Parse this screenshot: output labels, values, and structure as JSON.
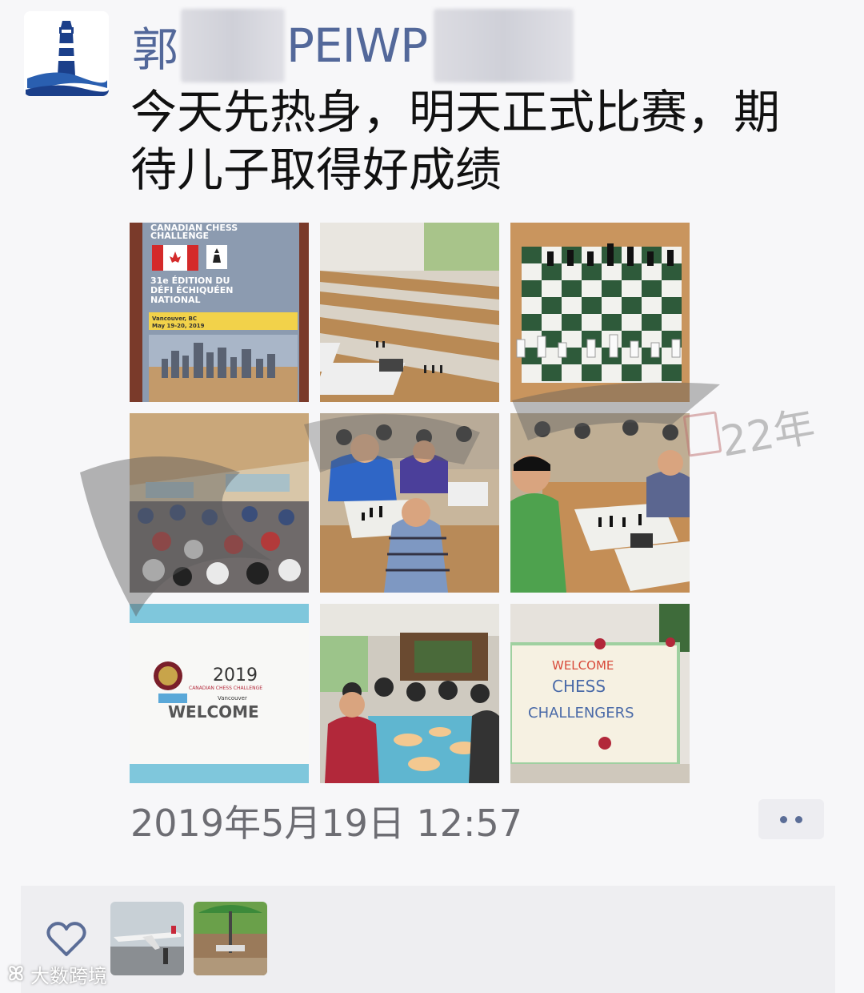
{
  "post": {
    "author_prefix": "郭",
    "author_middle": "PEIWP",
    "text": "今天先热身，明天正式比赛，期待儿子取得好成绩",
    "timestamp": "2019年5月19日 12:57",
    "avatar_icon": "lighthouse-icon"
  },
  "photos": [
    {
      "name": "photo-brochure",
      "lines": [
        "CANADIAN CHESS",
        "CHALLENGE",
        "31e ÉDITION DU",
        "DÉFI ÉCHIQUÉEN",
        "NATIONAL",
        "Vancouver, BC",
        "May 19-20, 2019"
      ]
    },
    {
      "name": "photo-chess-hall"
    },
    {
      "name": "photo-chessboard"
    },
    {
      "name": "photo-crowd-hall"
    },
    {
      "name": "photo-players-1"
    },
    {
      "name": "photo-players-2"
    },
    {
      "name": "photo-welcome-sign",
      "year": "2019",
      "subtitle": "CANADIAN CHESS CHALLENGE",
      "city": "Vancouver",
      "welcome": "WELCOME"
    },
    {
      "name": "photo-dining"
    },
    {
      "name": "photo-cake",
      "lines": [
        "WELCOME",
        "CHESS",
        "CHALLENGERS"
      ]
    }
  ],
  "likes": {
    "icon": "heart-icon",
    "avatars": [
      "airplane-avatar",
      "umbrella-patio-avatar"
    ]
  },
  "watermark": {
    "text": "大数跨境",
    "stamp_years": "22年"
  },
  "colors": {
    "name": "#53689a",
    "timestamp": "#6d6d73",
    "like_bg": "#eeeef1"
  }
}
